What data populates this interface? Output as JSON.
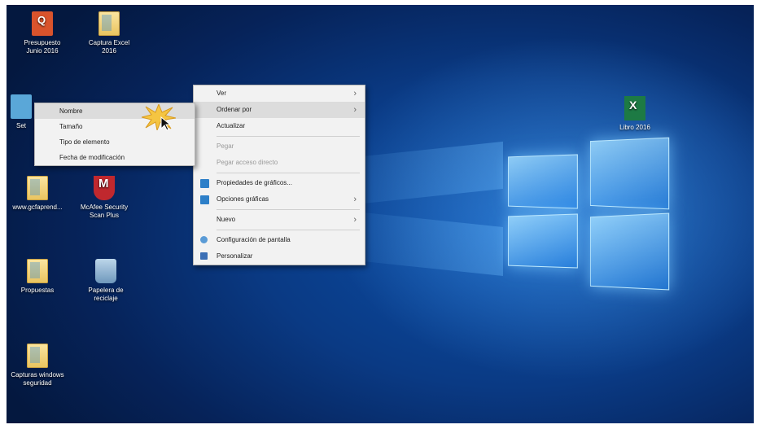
{
  "desktop": {
    "icons": [
      {
        "id": "presupuesto",
        "label": "Presupuesto\nJunio 2016",
        "type": "pdfish"
      },
      {
        "id": "captura-excel",
        "label": "Captura Excel\n2016",
        "type": "folder"
      },
      {
        "id": "set",
        "label": "Set",
        "type": "setting"
      },
      {
        "id": "gcfaprende",
        "label": "www.gcfaprend...",
        "type": "folder"
      },
      {
        "id": "mcafee",
        "label": "McAfee Security\nScan Plus",
        "type": "mcafee"
      },
      {
        "id": "propuestas",
        "label": "Propuestas",
        "type": "folder"
      },
      {
        "id": "papelera",
        "label": "Papelera de\nreciclaje",
        "type": "recycle"
      },
      {
        "id": "capturas-windows",
        "label": "Capturas windows\nseguridad",
        "type": "folder"
      },
      {
        "id": "excel-file",
        "label": "Libro 2016",
        "type": "excel"
      }
    ]
  },
  "context_menu": {
    "items": [
      {
        "label": "Ver",
        "submenu": true
      },
      {
        "label": "Ordenar por",
        "submenu": true,
        "highlighted": true
      },
      {
        "label": "Actualizar"
      },
      {
        "sep": true
      },
      {
        "label": "Pegar",
        "disabled": true
      },
      {
        "label": "Pegar acceso directo",
        "disabled": true
      },
      {
        "sep": true
      },
      {
        "label": "Propiedades de gráficos...",
        "icon": "graphics-icon"
      },
      {
        "label": "Opciones gráficas",
        "icon": "graphics-icon",
        "submenu": true
      },
      {
        "sep": true
      },
      {
        "label": "Nuevo",
        "submenu": true
      },
      {
        "sep": true
      },
      {
        "label": "Configuración de pantalla",
        "icon": "display-icon"
      },
      {
        "label": "Personalizar",
        "icon": "personalize-icon"
      }
    ]
  },
  "sort_submenu": {
    "items": [
      {
        "label": "Nombre",
        "highlighted": true
      },
      {
        "label": "Tamaño"
      },
      {
        "label": "Tipo de elemento"
      },
      {
        "label": "Fecha de modificación"
      }
    ]
  },
  "colors": {
    "desktop_dark": "#04183f",
    "desktop_accent": "#2b88d8",
    "menu_bg": "#f2f2f2",
    "menu_highlight": "#dcdcdc",
    "burst": "#f5c542"
  }
}
